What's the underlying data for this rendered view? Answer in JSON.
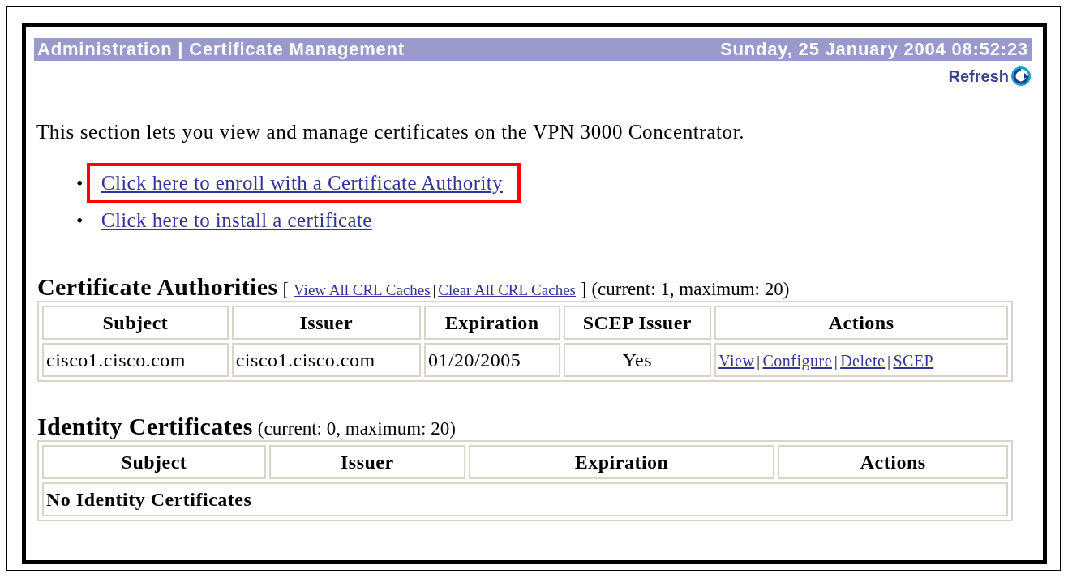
{
  "header": {
    "title": "Administration | Certificate Management",
    "datetime": "Sunday, 25 January 2004 08:52:23",
    "refresh": "Refresh"
  },
  "intro": "This section lets you view and manage certificates on the VPN 3000 Concentrator.",
  "links": [
    {
      "bullet": "•",
      "label": "Click here to enroll with a Certificate Authority",
      "highlighted": true
    },
    {
      "bullet": "•",
      "label": "Click here to install a certificate",
      "highlighted": false
    }
  ],
  "separator": "|",
  "ca_section": {
    "title": "Certificate Authorities",
    "bracket_open": "[",
    "bracket_close": "]",
    "links": [
      "View All CRL Caches",
      "Clear All CRL Caches"
    ],
    "summary": "(current: 1, maximum: 20)",
    "columns": [
      "Subject",
      "Issuer",
      "Expiration",
      "SCEP Issuer",
      "Actions"
    ],
    "rows": [
      {
        "subject": "cisco1.cisco.com",
        "issuer": "cisco1.cisco.com",
        "expiration": "01/20/2005",
        "scep_issuer": "Yes",
        "actions": [
          "View",
          "Configure",
          "Delete",
          "SCEP"
        ]
      }
    ]
  },
  "identity_section": {
    "title": "Identity Certificates",
    "summary": "(current: 0, maximum: 20)",
    "columns": [
      "Subject",
      "Issuer",
      "Expiration",
      "Actions"
    ],
    "empty_message": "No Identity Certificates"
  }
}
